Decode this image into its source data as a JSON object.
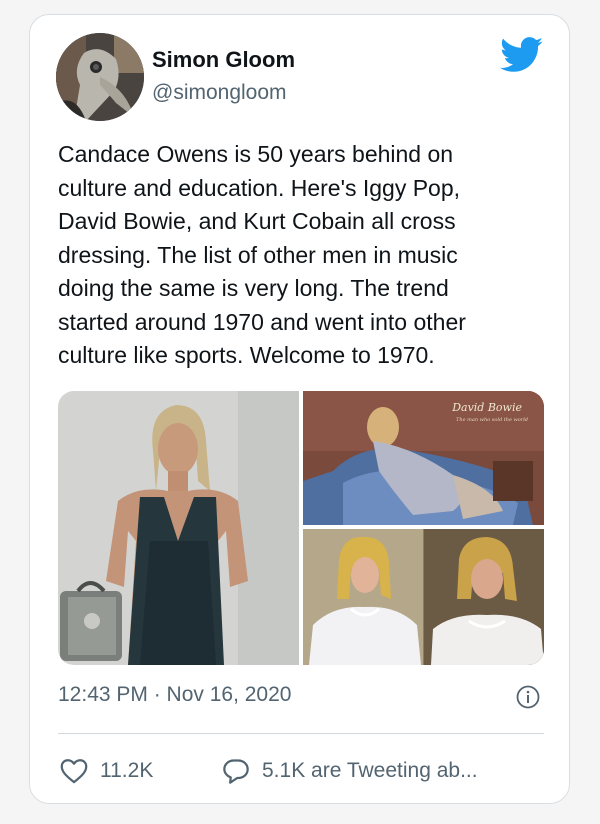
{
  "tweet": {
    "display_name": "Simon Gloom",
    "handle": "@simongloom",
    "text_lines": [
      "Candace Owens is 50 years behind on",
      "culture and education. Here's Iggy Pop,",
      "David Bowie, and Kurt Cobain all cross",
      "dressing. The list of other men in music",
      "doing the same is very long. The trend",
      "started around 1970 and went into other",
      "culture like sports. Welcome to 1970."
    ],
    "timestamp": "12:43 PM · Nov 16, 2020",
    "likes": "11.2K",
    "conversation": "5.1K are Tweeting ab..."
  },
  "media": {
    "album_title": "David Bowie",
    "album_subtitle": "The man who sold the world"
  },
  "icons": {
    "brand": "twitter-bird-icon",
    "info": "info-icon",
    "like": "heart-icon",
    "reply": "speech-bubble-icon"
  },
  "colors": {
    "twitter_blue": "#1d9bf0",
    "text": "#0f1419",
    "secondary": "#536471"
  }
}
